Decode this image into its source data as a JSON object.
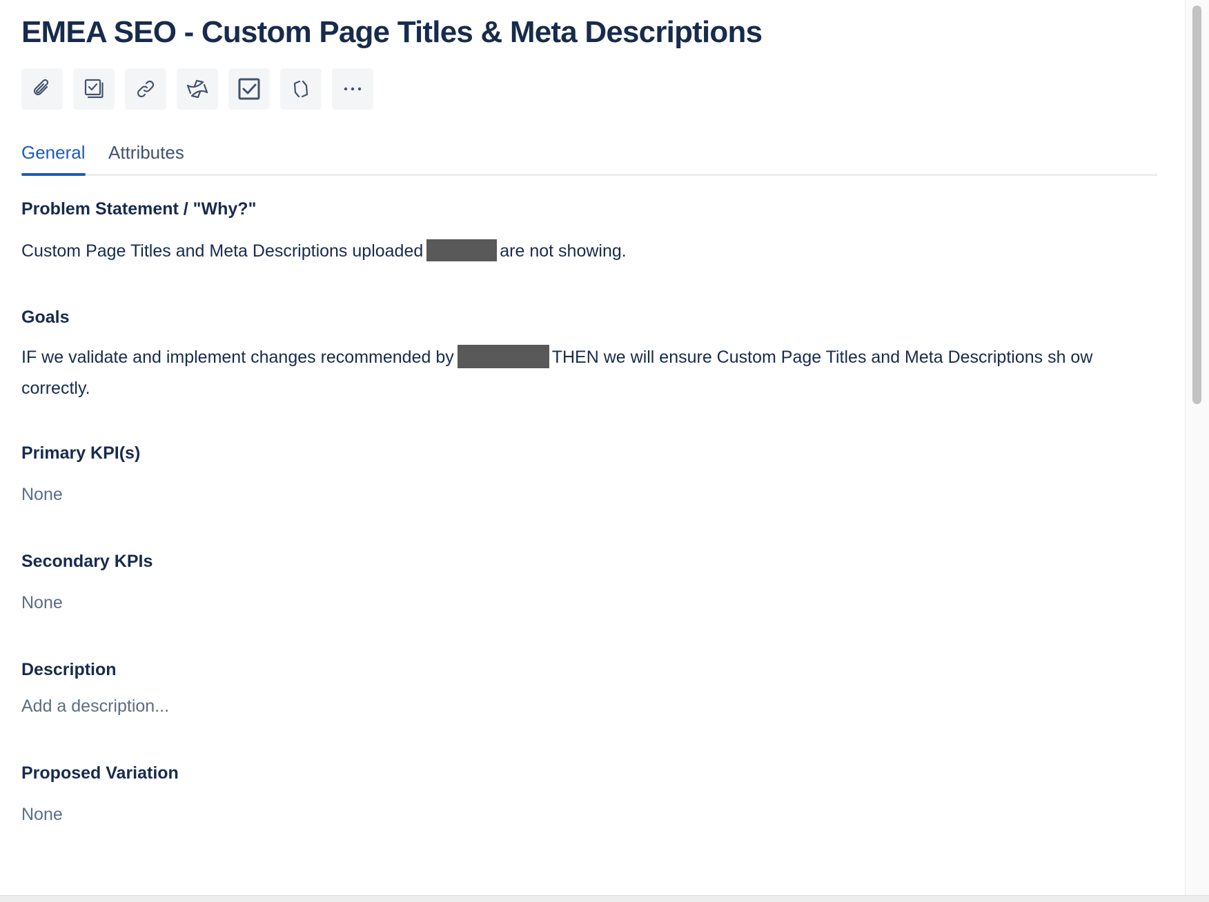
{
  "issue": {
    "title": "EMEA SEO - Custom Page Titles & Meta Descriptions"
  },
  "toolbar": {
    "buttons": [
      {
        "icon": "paperclip-icon",
        "name": "attach-button"
      },
      {
        "icon": "checklist-icon",
        "name": "add-checklist-button"
      },
      {
        "icon": "link-icon",
        "name": "link-issue-button"
      },
      {
        "icon": "confluence-icon",
        "name": "confluence-button"
      },
      {
        "icon": "checkbox-icon",
        "name": "checkbox-button"
      },
      {
        "icon": "link-app-icon",
        "name": "app-button"
      },
      {
        "icon": "more-icon",
        "name": "more-button"
      }
    ]
  },
  "tabs": [
    {
      "label": "General",
      "active": true
    },
    {
      "label": "Attributes",
      "active": false
    }
  ],
  "fields": {
    "problem_statement": {
      "label": "Problem Statement / \"Why?\"",
      "text_before": "Custom Page Titles and Meta Descriptions uploaded",
      "text_after": "are not showing."
    },
    "goals": {
      "label": "Goals",
      "text_before": "IF we validate and implement changes recommended by",
      "text_after": "THEN we will ensure Custom Page Titles and Meta Descriptions sh ow correctly."
    },
    "primary_kpis": {
      "label": "Primary KPI(s)",
      "value": "None"
    },
    "secondary_kpis": {
      "label": "Secondary KPIs",
      "value": "None"
    },
    "description": {
      "label": "Description",
      "placeholder": "Add a description..."
    },
    "proposed_variation": {
      "label": "Proposed Variation",
      "value": "None"
    }
  },
  "colors": {
    "text": "#172b4d",
    "muted": "#5e6c84",
    "accent": "#1d5bbf",
    "button_bg": "#f4f5f7",
    "redaction": "#595959"
  }
}
